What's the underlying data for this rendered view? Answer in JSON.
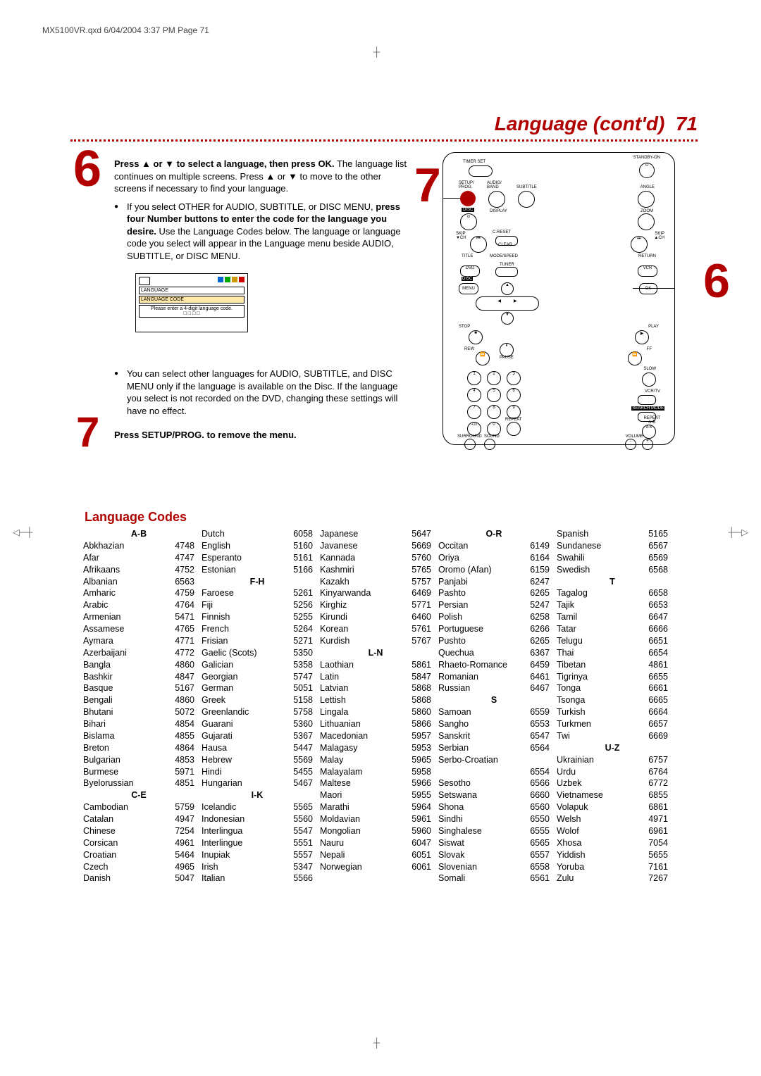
{
  "doc_header": "MX5100VR.qxd  6/04/2004  3:37 PM  Page 71",
  "page_title": "Language (cont'd)",
  "page_number": "71",
  "step6": {
    "big": "6",
    "lead": "Press ▲ or ▼ to select a language, then press OK.",
    "tail": " The language list continues on multiple screens. Press ▲ or ▼ to move to the other screens if necessary to find your language.",
    "bullet1_a": "If you select OTHER for AUDIO, SUBTITLE, or DISC MENU, ",
    "bullet1_b": "press four Number buttons to enter the code for the language you desire.",
    "bullet1_c": " Use the Language Codes below. The language or language code you select will appear in the Language menu beside AUDIO, SUBTITLE, or DISC MENU.",
    "panel_label1": "LANGUAGE",
    "panel_label2": "LANGUAGE CODE",
    "panel_label3": "Please enter a 4-digit language code.",
    "bullet2": "You can select other languages for AUDIO, SUBTITLE, and DISC MENU only if the language is available on the Disc. If the language you select is not recorded on the DVD, changing these settings will have no effect."
  },
  "step7": {
    "big": "7",
    "text": "Press SETUP/PROG. to remove the menu."
  },
  "remote_big6": "6",
  "remote_big7": "7",
  "remote_labels": {
    "timer_set": "TIMER SET",
    "standby": "STANDBY-ON",
    "setup": "SETUP/\nPROG.",
    "audio": "AUDIO/\nBAND",
    "subtitle": "SUBTITLE",
    "angle": "ANGLE",
    "disc": "DISC",
    "display": "DISPLAY",
    "zoom": "ZOOM",
    "skipd": "SKIP\n▼CH",
    "clear": "CLEAR",
    "skipu": "SKIP\n▲CH",
    "creset": "C.RESET",
    "title": "TITLE",
    "mode": "MODE/SPEED",
    "return": "RETURN",
    "dvd": "DVD",
    "tuner": "TUNER",
    "vcr": "VCR",
    "menu": "MENU",
    "ok": "OK",
    "stop": "STOP",
    "play": "PLAY",
    "rew": "REW",
    "pause": "PAUSE",
    "ff": "FF",
    "slow": "SLOW",
    "vcrtv": "VCR/TV",
    "searchmode": "SEARCH MODE",
    "plus10": "+10",
    "repeat": "REPEAT",
    "repeatab": "REPEAT\nA-B",
    "surround": "SURROUND",
    "sound": "SOUND",
    "volume": "VOLUME"
  },
  "codes_title": "Language Codes",
  "columns": [
    [
      {
        "head": "A-B"
      },
      {
        "n": "Abkhazian",
        "c": "4748"
      },
      {
        "n": "Afar",
        "c": "4747"
      },
      {
        "n": "Afrikaans",
        "c": "4752"
      },
      {
        "n": "Albanian",
        "c": "6563"
      },
      {
        "n": "Amharic",
        "c": "4759"
      },
      {
        "n": "Arabic",
        "c": "4764"
      },
      {
        "n": "Armenian",
        "c": "5471"
      },
      {
        "n": "Assamese",
        "c": "4765"
      },
      {
        "n": "Aymara",
        "c": "4771"
      },
      {
        "n": "Azerbaijani",
        "c": "4772"
      },
      {
        "n": "Bangla",
        "c": "4860"
      },
      {
        "n": "Bashkir",
        "c": "4847"
      },
      {
        "n": "Basque",
        "c": "5167"
      },
      {
        "n": "Bengali",
        "c": "4860"
      },
      {
        "n": "Bhutani",
        "c": "5072"
      },
      {
        "n": "Bihari",
        "c": "4854"
      },
      {
        "n": "Bislama",
        "c": "4855"
      },
      {
        "n": "Breton",
        "c": "4864"
      },
      {
        "n": "Bulgarian",
        "c": "4853"
      },
      {
        "n": "Burmese",
        "c": "5971"
      },
      {
        "n": "Byelorussian",
        "c": "4851"
      },
      {
        "head": "C-E"
      },
      {
        "n": "Cambodian",
        "c": "5759"
      },
      {
        "n": "Catalan",
        "c": "4947"
      },
      {
        "n": "Chinese",
        "c": "7254"
      },
      {
        "n": "Corsican",
        "c": "4961"
      },
      {
        "n": "Croatian",
        "c": "5464"
      },
      {
        "n": "Czech",
        "c": "4965"
      },
      {
        "n": "Danish",
        "c": "5047"
      }
    ],
    [
      {
        "n": "Dutch",
        "c": "6058"
      },
      {
        "n": "English",
        "c": "5160"
      },
      {
        "n": "Esperanto",
        "c": "5161"
      },
      {
        "n": "Estonian",
        "c": "5166"
      },
      {
        "head": "F-H"
      },
      {
        "n": "Faroese",
        "c": "5261"
      },
      {
        "n": "Fiji",
        "c": "5256"
      },
      {
        "n": "Finnish",
        "c": "5255"
      },
      {
        "n": "French",
        "c": "5264"
      },
      {
        "n": "Frisian",
        "c": "5271"
      },
      {
        "n": "Gaelic (Scots)",
        "c": "5350"
      },
      {
        "n": "Galician",
        "c": "5358"
      },
      {
        "n": "Georgian",
        "c": "5747"
      },
      {
        "n": "German",
        "c": "5051"
      },
      {
        "n": "Greek",
        "c": "5158"
      },
      {
        "n": "Greenlandic",
        "c": "5758"
      },
      {
        "n": "Guarani",
        "c": "5360"
      },
      {
        "n": "Gujarati",
        "c": "5367"
      },
      {
        "n": "Hausa",
        "c": "5447"
      },
      {
        "n": "Hebrew",
        "c": "5569"
      },
      {
        "n": "Hindi",
        "c": "5455"
      },
      {
        "n": "Hungarian",
        "c": "5467"
      },
      {
        "head": "I-K"
      },
      {
        "n": "Icelandic",
        "c": "5565"
      },
      {
        "n": "Indonesian",
        "c": "5560"
      },
      {
        "n": "Interlingua",
        "c": "5547"
      },
      {
        "n": "Interlingue",
        "c": "5551"
      },
      {
        "n": "Inupiak",
        "c": "5557"
      },
      {
        "n": "Irish",
        "c": "5347"
      },
      {
        "n": "Italian",
        "c": "5566"
      }
    ],
    [
      {
        "n": "Japanese",
        "c": "5647"
      },
      {
        "n": "Javanese",
        "c": "5669"
      },
      {
        "n": "Kannada",
        "c": "5760"
      },
      {
        "n": "Kashmiri",
        "c": "5765"
      },
      {
        "n": "Kazakh",
        "c": "5757"
      },
      {
        "n": "Kinyarwanda",
        "c": "6469"
      },
      {
        "n": "Kirghiz",
        "c": "5771"
      },
      {
        "n": "Kirundi",
        "c": "6460"
      },
      {
        "n": "Korean",
        "c": "5761"
      },
      {
        "n": "Kurdish",
        "c": "5767"
      },
      {
        "head": "L-N"
      },
      {
        "n": "Laothian",
        "c": "5861"
      },
      {
        "n": "Latin",
        "c": "5847"
      },
      {
        "n": "Latvian",
        "c": "5868"
      },
      {
        "n": "Lettish",
        "c": "5868"
      },
      {
        "n": "Lingala",
        "c": "5860"
      },
      {
        "n": "Lithuanian",
        "c": "5866"
      },
      {
        "n": "Macedonian",
        "c": "5957"
      },
      {
        "n": "Malagasy",
        "c": "5953"
      },
      {
        "n": "Malay",
        "c": "5965"
      },
      {
        "n": "Malayalam",
        "c": "5958"
      },
      {
        "n": "Maltese",
        "c": "5966"
      },
      {
        "n": "Maori",
        "c": "5955"
      },
      {
        "n": "Marathi",
        "c": "5964"
      },
      {
        "n": "Moldavian",
        "c": "5961"
      },
      {
        "n": "Mongolian",
        "c": "5960"
      },
      {
        "n": "Nauru",
        "c": "6047"
      },
      {
        "n": "Nepali",
        "c": "6051"
      },
      {
        "n": "Norwegian",
        "c": "6061"
      }
    ],
    [
      {
        "head": "O-R"
      },
      {
        "n": "Occitan",
        "c": "6149"
      },
      {
        "n": "Oriya",
        "c": "6164"
      },
      {
        "n": "Oromo (Afan)",
        "c": "6159"
      },
      {
        "n": "Panjabi",
        "c": "6247"
      },
      {
        "n": "Pashto",
        "c": "6265"
      },
      {
        "n": "Persian",
        "c": "5247"
      },
      {
        "n": "Polish",
        "c": "6258"
      },
      {
        "n": "Portuguese",
        "c": "6266"
      },
      {
        "n": "Pushto",
        "c": "6265"
      },
      {
        "n": "Quechua",
        "c": "6367"
      },
      {
        "n": "Rhaeto-Romance",
        "c": "6459"
      },
      {
        "n": "Romanian",
        "c": "6461"
      },
      {
        "n": "Russian",
        "c": "6467"
      },
      {
        "head": "S"
      },
      {
        "n": "Samoan",
        "c": "6559"
      },
      {
        "n": "Sangho",
        "c": "6553"
      },
      {
        "n": "Sanskrit",
        "c": "6547"
      },
      {
        "n": "Serbian",
        "c": "6564"
      },
      {
        "n": "Serbo-Croatian",
        "c": ""
      },
      {
        "n": "",
        "c": "6554"
      },
      {
        "n": "Sesotho",
        "c": "6566"
      },
      {
        "n": "Setswana",
        "c": "6660"
      },
      {
        "n": "Shona",
        "c": "6560"
      },
      {
        "n": "Sindhi",
        "c": "6550"
      },
      {
        "n": "Singhalese",
        "c": "6555"
      },
      {
        "n": "Siswat",
        "c": "6565"
      },
      {
        "n": "Slovak",
        "c": "6557"
      },
      {
        "n": "Slovenian",
        "c": "6558"
      },
      {
        "n": "Somali",
        "c": "6561"
      }
    ],
    [
      {
        "n": "Spanish",
        "c": "5165"
      },
      {
        "n": "Sundanese",
        "c": "6567"
      },
      {
        "n": "Swahili",
        "c": "6569"
      },
      {
        "n": "Swedish",
        "c": "6568"
      },
      {
        "head": "T"
      },
      {
        "n": "Tagalog",
        "c": "6658"
      },
      {
        "n": "Tajik",
        "c": "6653"
      },
      {
        "n": "Tamil",
        "c": "6647"
      },
      {
        "n": "Tatar",
        "c": "6666"
      },
      {
        "n": "Telugu",
        "c": "6651"
      },
      {
        "n": "Thai",
        "c": "6654"
      },
      {
        "n": "Tibetan",
        "c": "4861"
      },
      {
        "n": "Tigrinya",
        "c": "6655"
      },
      {
        "n": "Tonga",
        "c": "6661"
      },
      {
        "n": "Tsonga",
        "c": "6665"
      },
      {
        "n": "Turkish",
        "c": "6664"
      },
      {
        "n": "Turkmen",
        "c": "6657"
      },
      {
        "n": "Twi",
        "c": "6669"
      },
      {
        "head": "U-Z"
      },
      {
        "n": "Ukrainian",
        "c": "6757"
      },
      {
        "n": "Urdu",
        "c": "6764"
      },
      {
        "n": "Uzbek",
        "c": "6772"
      },
      {
        "n": "Vietnamese",
        "c": "6855"
      },
      {
        "n": "Volapuk",
        "c": "6861"
      },
      {
        "n": "Welsh",
        "c": "4971"
      },
      {
        "n": "Wolof",
        "c": "6961"
      },
      {
        "n": "Xhosa",
        "c": "7054"
      },
      {
        "n": "Yiddish",
        "c": "5655"
      },
      {
        "n": "Yoruba",
        "c": "7161"
      },
      {
        "n": "Zulu",
        "c": "7267"
      }
    ]
  ]
}
